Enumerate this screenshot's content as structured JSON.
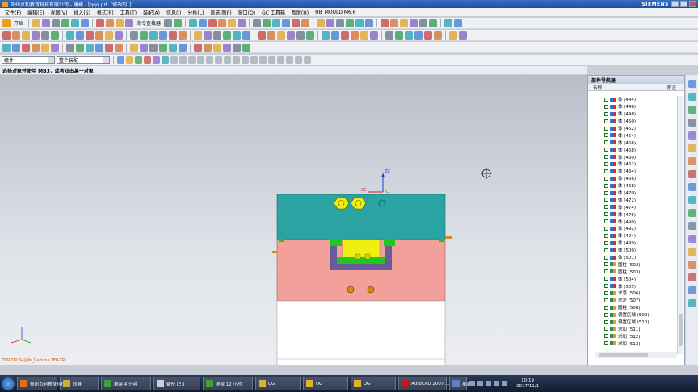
{
  "window": {
    "title": "郑州贞利教育科技有限公司 - 建模 - [qqq.prt（修改的）]",
    "brand": "SIEMENS"
  },
  "menu": [
    "文件(F)",
    "编辑(E)",
    "视图(V)",
    "插入(S)",
    "格式(R)",
    "工具(T)",
    "装配(A)",
    "信息(I)",
    "分析(L)",
    "首选项(P)",
    "窗口(O)",
    "GC 工具箱",
    "帮助(H)",
    "HB_MOULD M6.6"
  ],
  "toolbar": {
    "start_label": "开始",
    "command_finder_label": "命令查找器"
  },
  "selection": {
    "filter_value": "组件",
    "scope_value": "整个装配"
  },
  "cue_line": "选择对象并使用 MB3，或者双击某一对象",
  "status_line": "TFR-TRI 64(J9h_Gamma TFR-TRI",
  "navigator": {
    "title": "部件导航器",
    "col_name": "名称",
    "col_note": "附注",
    "rows": [
      {
        "icon": "body",
        "label": "体 (444)"
      },
      {
        "icon": "body",
        "label": "体 (446)"
      },
      {
        "icon": "body",
        "label": "体 (448)"
      },
      {
        "icon": "body",
        "label": "体 (450)"
      },
      {
        "icon": "body",
        "label": "体 (452)"
      },
      {
        "icon": "body",
        "label": "体 (454)"
      },
      {
        "icon": "body",
        "label": "体 (456)"
      },
      {
        "icon": "body",
        "label": "体 (458)"
      },
      {
        "icon": "body",
        "label": "体 (460)"
      },
      {
        "icon": "body",
        "label": "体 (462)"
      },
      {
        "icon": "body",
        "label": "体 (464)"
      },
      {
        "icon": "body",
        "label": "体 (466)"
      },
      {
        "icon": "body",
        "label": "体 (468)"
      },
      {
        "icon": "body",
        "label": "体 (470)"
      },
      {
        "icon": "body",
        "label": "体 (472)"
      },
      {
        "icon": "body",
        "label": "体 (474)"
      },
      {
        "icon": "body",
        "label": "体 (476)"
      },
      {
        "icon": "body",
        "label": "体 (490)"
      },
      {
        "icon": "body",
        "label": "体 (492)"
      },
      {
        "icon": "body",
        "label": "体 (494)"
      },
      {
        "icon": "body",
        "label": "体 (499)"
      },
      {
        "icon": "body",
        "label": "体 (500)"
      },
      {
        "icon": "body",
        "label": "体 (501)"
      },
      {
        "icon": "feature",
        "label": "圆柱 (502)"
      },
      {
        "icon": "feature",
        "label": "圆柱 (503)"
      },
      {
        "icon": "body",
        "label": "体 (504)"
      },
      {
        "icon": "body",
        "label": "体 (505)"
      },
      {
        "icon": "feature",
        "label": "求差 (506)"
      },
      {
        "icon": "feature",
        "label": "求差 (507)"
      },
      {
        "icon": "feature",
        "label": "圆柱 (508)"
      },
      {
        "icon": "feature",
        "label": "偏置区域 (509)"
      },
      {
        "icon": "feature",
        "label": "偏置区域 (510)"
      },
      {
        "icon": "feature",
        "label": "求和 (511)"
      },
      {
        "icon": "feature",
        "label": "求和 (512)"
      },
      {
        "icon": "feature",
        "label": "求和 (513)"
      }
    ]
  },
  "axes": {
    "zc": "ZC",
    "xc": "XC",
    "yc": "YC"
  },
  "taskbar": {
    "items": [
      "郑州贞利教育科技...",
      "同屏",
      "剩余 4 分钟",
      "备份 (E:)",
      "剩余 12 小时",
      "UG",
      "UG",
      "UG",
      "AutoCAD 2007 ...",
      "桌面"
    ],
    "time": "10:19",
    "date": "2017/11/1"
  },
  "colors": {
    "plate_top": "#2aa3a3",
    "plate_mid": "#f4a09a",
    "plate_bottom": "#ffffff",
    "insert": "#f0f010",
    "green": "#1ec81e",
    "purple": "#6a5a9a",
    "orange": "#d88a10"
  }
}
